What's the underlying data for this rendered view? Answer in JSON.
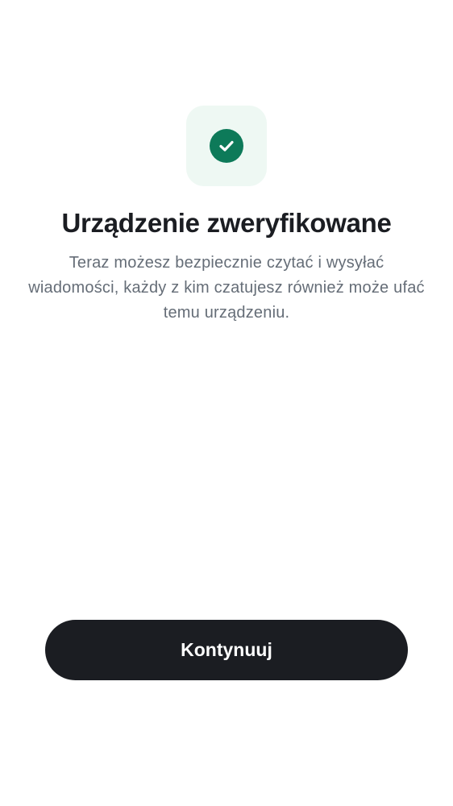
{
  "verification": {
    "icon": "checkmark-circle-icon",
    "title": "Urządzenie zweryfikowane",
    "description": "Teraz możesz bezpiecznie czytać i wysyłać wiadomości, każdy z kim czatujesz również może ufać temu urządzeniu.",
    "continue_label": "Kontynuuj"
  },
  "colors": {
    "accent": "#0d7a59",
    "tile_background": "#eef8f3",
    "button_background": "#1b1d22",
    "title_text": "#1b1d22",
    "body_text": "#656d77"
  }
}
